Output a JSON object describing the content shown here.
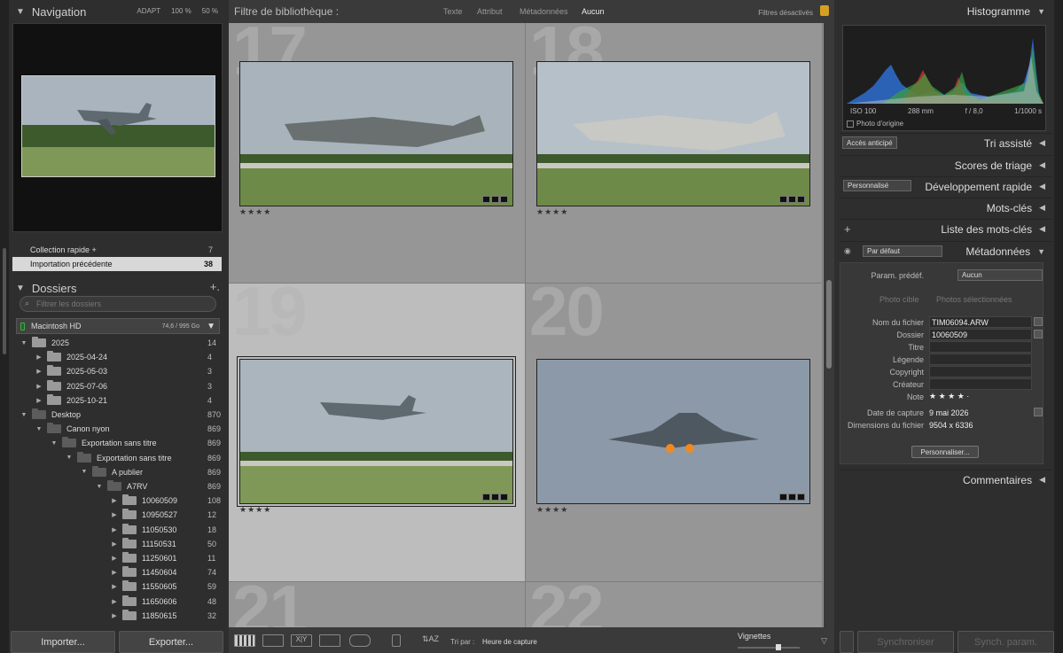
{
  "left": {
    "nav_title": "Navigation",
    "nav_opts": [
      "ADAPT",
      "100 %",
      "50 %"
    ],
    "collections": [
      {
        "label": "Collection rapide +",
        "count": "7"
      },
      {
        "label": "Importation précédente",
        "count": "38"
      }
    ],
    "folders_title": "Dossiers",
    "filter_placeholder": "Filtrer les dossiers",
    "volume": {
      "name": "Macintosh HD",
      "capacity": "74,6 / 995 Go"
    },
    "tree": [
      {
        "label": "2025",
        "count": "14"
      },
      {
        "label": "2025-04-24",
        "count": "4"
      },
      {
        "label": "2025-05-03",
        "count": "3"
      },
      {
        "label": "2025-07-06",
        "count": "3"
      },
      {
        "label": "2025-10-21",
        "count": "4"
      },
      {
        "label": "Desktop",
        "count": "870"
      },
      {
        "label": "Canon nyon",
        "count": "869"
      },
      {
        "label": "Exportation sans titre",
        "count": "869"
      },
      {
        "label": "Exportation sans titre",
        "count": "869"
      },
      {
        "label": "A publier",
        "count": "869"
      },
      {
        "label": "A7RV",
        "count": "869"
      },
      {
        "label": "10060509",
        "count": "108"
      },
      {
        "label": "10950527",
        "count": "12"
      },
      {
        "label": "11050530",
        "count": "18"
      },
      {
        "label": "11150531",
        "count": "50"
      },
      {
        "label": "11250601",
        "count": "11"
      },
      {
        "label": "11450604",
        "count": "74"
      },
      {
        "label": "11550605",
        "count": "59"
      },
      {
        "label": "11650606",
        "count": "48"
      },
      {
        "label": "11850615",
        "count": "32"
      }
    ],
    "import_btn": "Importer...",
    "export_btn": "Exporter..."
  },
  "filter_bar": {
    "title": "Filtre de bibliothèque :",
    "tabs": [
      "Texte",
      "Attribut",
      "Métadonnées",
      "Aucun"
    ],
    "status": "Filtres désactivés"
  },
  "grid": {
    "cells": [
      {
        "num": "17",
        "stars": "★★★★"
      },
      {
        "num": "18",
        "stars": "★★★★"
      },
      {
        "num": "19",
        "stars": "★★★★"
      },
      {
        "num": "20",
        "stars": "★★★★"
      },
      {
        "num": "21"
      },
      {
        "num": "22"
      }
    ]
  },
  "toolbar": {
    "sort_label": "Tri par :",
    "sort_value": "Heure de capture",
    "thumbs_label": "Vignettes",
    "thumb_size": 0.66
  },
  "right": {
    "histogram_title": "Histogramme",
    "histo_info": [
      "ISO 100",
      "288 mm",
      "f / 8,0",
      "1/1000 s"
    ],
    "photo_origine": "Photo d'origine",
    "acces_btn": "Accès anticipé",
    "tri_assiste": "Tri assisté",
    "scores": "Scores de triage",
    "perso_sel": "Personnalisé",
    "dev_rapide": "Développement rapide",
    "mots_cles": "Mots-clés",
    "liste_mots": "Liste des mots-clés",
    "defaut_sel": "Par défaut",
    "metadonnees": "Métadonnées",
    "param_label": "Param. prédéf.",
    "param_val": "Aucun",
    "photo_cible": "Photo cible",
    "photos_sel": "Photos sélectionnées",
    "meta": [
      {
        "label": "Nom du fichier",
        "value": "TIM06094.ARW"
      },
      {
        "label": "Dossier",
        "value": "10060509"
      },
      {
        "label": "Titre",
        "value": ""
      },
      {
        "label": "Légende",
        "value": ""
      },
      {
        "label": "Copyright",
        "value": ""
      },
      {
        "label": "Créateur",
        "value": ""
      },
      {
        "label": "Note",
        "value": "★ ★ ★ ★ ·"
      },
      {
        "label": "Date de capture",
        "value": "9 mai 2026"
      },
      {
        "label": "Dimensions du fichier",
        "value": "9504 x 6336"
      }
    ],
    "perso_btn": "Personnaliser...",
    "commentaires": "Commentaires",
    "sync_btn": "Synchroniser",
    "sync_param_btn": "Synch. param."
  }
}
